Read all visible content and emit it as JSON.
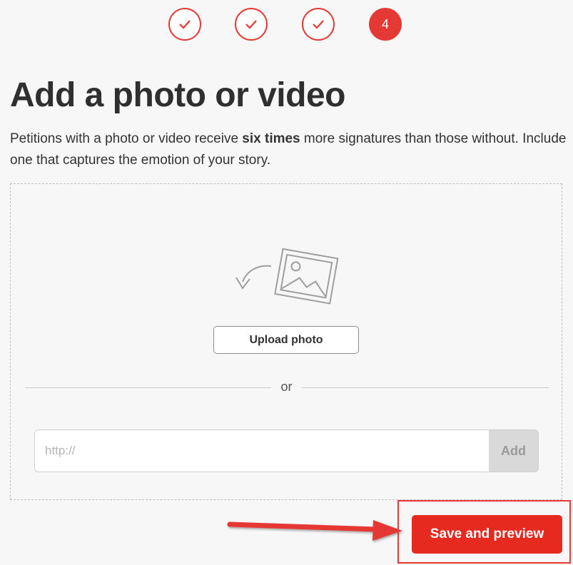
{
  "steps": [
    {
      "state": "done",
      "icon": "check-icon"
    },
    {
      "state": "done",
      "icon": "check-icon"
    },
    {
      "state": "done",
      "icon": "check-icon"
    },
    {
      "state": "current",
      "label": "4"
    }
  ],
  "page": {
    "title": "Add a photo or video",
    "intro_before": "Petitions with a photo or video receive ",
    "intro_bold": "six times",
    "intro_after": " more signatures than those without. Include one that captures the emotion of your story."
  },
  "upload": {
    "illustration_icon": "photo-upload-icon",
    "button_label": "Upload photo",
    "divider_text": "or"
  },
  "url_field": {
    "placeholder": "http://",
    "value": "",
    "add_label": "Add"
  },
  "actions": {
    "save_label": "Save and preview"
  },
  "colors": {
    "accent": "#e53935",
    "primary_button": "#e62a20",
    "background": "#f7f7f7"
  }
}
